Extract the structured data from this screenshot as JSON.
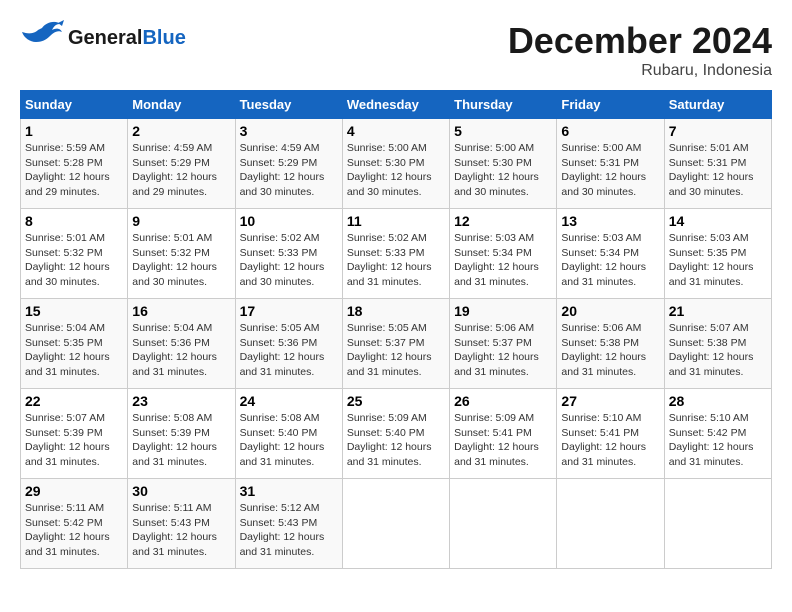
{
  "header": {
    "logo_line1": "General",
    "logo_line2": "Blue",
    "month": "December 2024",
    "location": "Rubaru, Indonesia"
  },
  "weekdays": [
    "Sunday",
    "Monday",
    "Tuesday",
    "Wednesday",
    "Thursday",
    "Friday",
    "Saturday"
  ],
  "weeks": [
    [
      {
        "day": "1",
        "sunrise": "5:59 AM",
        "sunset": "5:28 PM",
        "daylight": "12 hours and 29 minutes"
      },
      {
        "day": "2",
        "sunrise": "4:59 AM",
        "sunset": "5:29 PM",
        "daylight": "12 hours and 29 minutes"
      },
      {
        "day": "3",
        "sunrise": "4:59 AM",
        "sunset": "5:29 PM",
        "daylight": "12 hours and 30 minutes"
      },
      {
        "day": "4",
        "sunrise": "5:00 AM",
        "sunset": "5:30 PM",
        "daylight": "12 hours and 30 minutes"
      },
      {
        "day": "5",
        "sunrise": "5:00 AM",
        "sunset": "5:30 PM",
        "daylight": "12 hours and 30 minutes"
      },
      {
        "day": "6",
        "sunrise": "5:00 AM",
        "sunset": "5:31 PM",
        "daylight": "12 hours and 30 minutes"
      },
      {
        "day": "7",
        "sunrise": "5:01 AM",
        "sunset": "5:31 PM",
        "daylight": "12 hours and 30 minutes"
      }
    ],
    [
      {
        "day": "8",
        "sunrise": "5:01 AM",
        "sunset": "5:32 PM",
        "daylight": "12 hours and 30 minutes"
      },
      {
        "day": "9",
        "sunrise": "5:01 AM",
        "sunset": "5:32 PM",
        "daylight": "12 hours and 30 minutes"
      },
      {
        "day": "10",
        "sunrise": "5:02 AM",
        "sunset": "5:33 PM",
        "daylight": "12 hours and 30 minutes"
      },
      {
        "day": "11",
        "sunrise": "5:02 AM",
        "sunset": "5:33 PM",
        "daylight": "12 hours and 31 minutes"
      },
      {
        "day": "12",
        "sunrise": "5:03 AM",
        "sunset": "5:34 PM",
        "daylight": "12 hours and 31 minutes"
      },
      {
        "day": "13",
        "sunrise": "5:03 AM",
        "sunset": "5:34 PM",
        "daylight": "12 hours and 31 minutes"
      },
      {
        "day": "14",
        "sunrise": "5:03 AM",
        "sunset": "5:35 PM",
        "daylight": "12 hours and 31 minutes"
      }
    ],
    [
      {
        "day": "15",
        "sunrise": "5:04 AM",
        "sunset": "5:35 PM",
        "daylight": "12 hours and 31 minutes"
      },
      {
        "day": "16",
        "sunrise": "5:04 AM",
        "sunset": "5:36 PM",
        "daylight": "12 hours and 31 minutes"
      },
      {
        "day": "17",
        "sunrise": "5:05 AM",
        "sunset": "5:36 PM",
        "daylight": "12 hours and 31 minutes"
      },
      {
        "day": "18",
        "sunrise": "5:05 AM",
        "sunset": "5:37 PM",
        "daylight": "12 hours and 31 minutes"
      },
      {
        "day": "19",
        "sunrise": "5:06 AM",
        "sunset": "5:37 PM",
        "daylight": "12 hours and 31 minutes"
      },
      {
        "day": "20",
        "sunrise": "5:06 AM",
        "sunset": "5:38 PM",
        "daylight": "12 hours and 31 minutes"
      },
      {
        "day": "21",
        "sunrise": "5:07 AM",
        "sunset": "5:38 PM",
        "daylight": "12 hours and 31 minutes"
      }
    ],
    [
      {
        "day": "22",
        "sunrise": "5:07 AM",
        "sunset": "5:39 PM",
        "daylight": "12 hours and 31 minutes"
      },
      {
        "day": "23",
        "sunrise": "5:08 AM",
        "sunset": "5:39 PM",
        "daylight": "12 hours and 31 minutes"
      },
      {
        "day": "24",
        "sunrise": "5:08 AM",
        "sunset": "5:40 PM",
        "daylight": "12 hours and 31 minutes"
      },
      {
        "day": "25",
        "sunrise": "5:09 AM",
        "sunset": "5:40 PM",
        "daylight": "12 hours and 31 minutes"
      },
      {
        "day": "26",
        "sunrise": "5:09 AM",
        "sunset": "5:41 PM",
        "daylight": "12 hours and 31 minutes"
      },
      {
        "day": "27",
        "sunrise": "5:10 AM",
        "sunset": "5:41 PM",
        "daylight": "12 hours and 31 minutes"
      },
      {
        "day": "28",
        "sunrise": "5:10 AM",
        "sunset": "5:42 PM",
        "daylight": "12 hours and 31 minutes"
      }
    ],
    [
      {
        "day": "29",
        "sunrise": "5:11 AM",
        "sunset": "5:42 PM",
        "daylight": "12 hours and 31 minutes"
      },
      {
        "day": "30",
        "sunrise": "5:11 AM",
        "sunset": "5:43 PM",
        "daylight": "12 hours and 31 minutes"
      },
      {
        "day": "31",
        "sunrise": "5:12 AM",
        "sunset": "5:43 PM",
        "daylight": "12 hours and 31 minutes"
      },
      null,
      null,
      null,
      null
    ]
  ]
}
